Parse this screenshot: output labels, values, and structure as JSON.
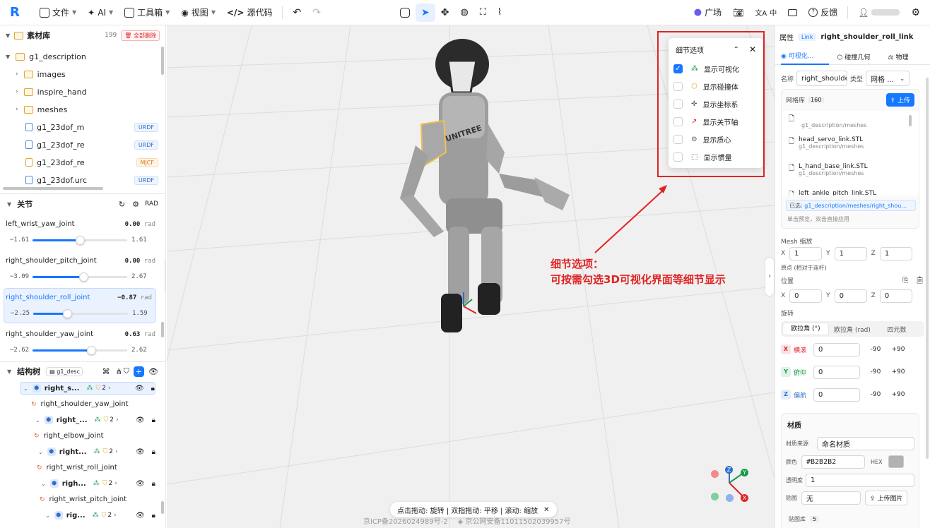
{
  "toolbar": {
    "file": "文件",
    "ai": "AI",
    "toolbox": "工具箱",
    "view": "视图",
    "source": "源代码",
    "plaza": "广场",
    "lang": "中",
    "feedback": "反馈"
  },
  "assets": {
    "title": "素材库",
    "count": "199",
    "delete_all": "全部删除",
    "root": "g1_description",
    "folders": [
      "images",
      "inspire_hand",
      "meshes"
    ],
    "files": [
      {
        "name": "g1_23dof_m",
        "type": "URDF"
      },
      {
        "name": "g1_23dof_re",
        "type": "URDF"
      },
      {
        "name": "g1_23dof_re",
        "type": "MJCF"
      },
      {
        "name": "g1_23dof.urc",
        "type": "URDF"
      }
    ]
  },
  "joints": {
    "title": "关节",
    "unit_toggle": "RAD",
    "items": [
      {
        "name": "left_wrist_yaw_joint",
        "value": "0.00",
        "unit": "rad",
        "min": "−1.61",
        "max": "1.61",
        "pos": 0.5
      },
      {
        "name": "right_shoulder_pitch_joint",
        "value": "0.00",
        "unit": "rad",
        "min": "−3.09",
        "max": "2.67",
        "pos": 0.54
      },
      {
        "name": "right_shoulder_roll_joint",
        "value": "−0.87",
        "unit": "rad",
        "min": "−2.25",
        "max": "1.59",
        "pos": 0.36
      },
      {
        "name": "right_shoulder_yaw_joint",
        "value": "0.63",
        "unit": "rad",
        "min": "−2.62",
        "max": "2.62",
        "pos": 0.62
      }
    ]
  },
  "tree": {
    "title": "结构树",
    "selector": "g1_desc",
    "rows": [
      {
        "label": "right_s...",
        "kind": "link",
        "count": "2",
        "selected": true
      },
      {
        "label": "right_shoulder_yaw_joint",
        "kind": "joint"
      },
      {
        "label": "right_...",
        "kind": "link",
        "count": "2"
      },
      {
        "label": "right_elbow_joint",
        "kind": "joint"
      },
      {
        "label": "right...",
        "kind": "link",
        "count": "2"
      },
      {
        "label": "right_wrist_roll_joint",
        "kind": "joint"
      },
      {
        "label": "righ...",
        "kind": "link",
        "count": "2"
      },
      {
        "label": "right_wrist_pitch_joint",
        "kind": "joint"
      },
      {
        "label": "rig...",
        "kind": "link",
        "count": "2"
      }
    ]
  },
  "detail_popup": {
    "title": "细节选项",
    "options": [
      {
        "label": "显示可视化",
        "checked": true
      },
      {
        "label": "显示碰撞体",
        "checked": false
      },
      {
        "label": "显示坐标系",
        "checked": false
      },
      {
        "label": "显示关节轴",
        "checked": false
      },
      {
        "label": "显示质心",
        "checked": false
      },
      {
        "label": "显示惯量",
        "checked": false
      }
    ]
  },
  "annotation": {
    "line1": "细节选项：",
    "line2": "可按需勾选3D可视化界面等细节显示"
  },
  "viewport": {
    "hint": "点击拖动: 旋转 | 双指拖动: 平移 | 滚动: 缩放",
    "icp": "京ICP备2026024989号-2",
    "police": "京公网安备11011502039957号",
    "gizmo": {
      "x": "X",
      "y": "Y",
      "z": "Z"
    }
  },
  "properties": {
    "title": "属性",
    "kind": "Link",
    "name": "right_shoulder_roll_link",
    "tabs": [
      "可视化...",
      "碰撞几何",
      "物理"
    ],
    "name_label": "名称",
    "name_value": "right_shoulde",
    "type_label": "类型",
    "type_value": "网格 ...",
    "mesh_lib_label": "网格库",
    "mesh_lib_count": "160",
    "upload": "上传",
    "mesh_path": "g1_description/meshes",
    "meshes": [
      {
        "file": "head_servo_link.STL",
        "path": "g1_description/meshes"
      },
      {
        "file": "L_hand_base_link.STL",
        "path": "g1_description/meshes"
      },
      {
        "file": "left_ankle_pitch_link.STL",
        "path": ""
      }
    ],
    "selected_label": "已选:",
    "selected_value": "g1_description/meshes/right_shou...",
    "mesh_hint": "单击预览，双击直接应用",
    "scale_label": "Mesh 缩放",
    "scale": {
      "x": "1",
      "y": "1",
      "z": "1"
    },
    "origin_label": "原点 (相对于连杆)",
    "position_label": "位置",
    "position": {
      "x": "0",
      "y": "0",
      "z": "0"
    },
    "rotation_label": "旋转",
    "rot_tabs": [
      "欧拉角 (°)",
      "欧拉角 (rad)",
      "四元数"
    ],
    "rotations": [
      {
        "axis": "X",
        "label": "横滚",
        "value": "0",
        "m": "-90",
        "p": "+90",
        "color": "#e02424"
      },
      {
        "axis": "Y",
        "label": "俯仰",
        "value": "0",
        "m": "-90",
        "p": "+90",
        "color": "#1a9a4a"
      },
      {
        "axis": "Z",
        "label": "偏航",
        "value": "0",
        "m": "-90",
        "p": "+90",
        "color": "#2f6fc9"
      }
    ],
    "material_title": "材质",
    "material_source_label": "材质来源",
    "material_source": "命名材质",
    "color_label": "颜色",
    "color_value": "#B2B2B2",
    "color_mode": "HEX",
    "opacity_label": "透明度",
    "opacity": "1",
    "texture_label": "贴图",
    "texture_value": "无",
    "upload_image": "上传图片",
    "texture_lib_label": "贴图库",
    "texture_lib_count": "5"
  }
}
